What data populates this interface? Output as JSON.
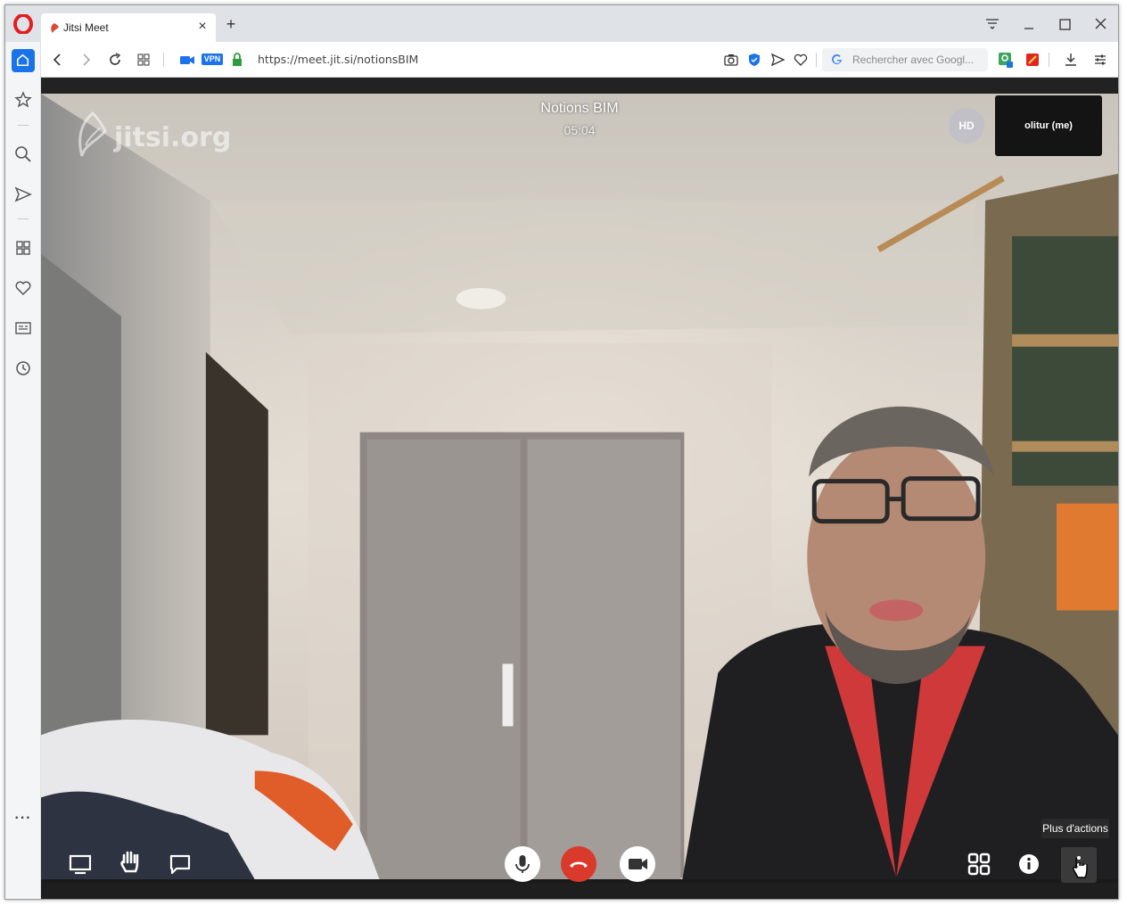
{
  "browser": {
    "tab_title": "Jitsi Meet",
    "tab_close": "×",
    "new_tab": "+",
    "url": "https://meet.jit.si/notionsBIM",
    "vpn_label": "VPN",
    "search_placeholder": "Rechercher avec Googl..."
  },
  "sidebar": {
    "items": [
      "home-icon",
      "star-icon",
      "search-icon",
      "send-icon",
      "apps-icon",
      "heart-icon",
      "news-icon",
      "history-icon"
    ],
    "more": "···"
  },
  "meeting": {
    "watermark": "jitsi.org",
    "title": "Notions BIM",
    "timer": "05:04",
    "quality_badge": "HD",
    "self_name": "olitur (me)",
    "tooltip": "Plus d'actions"
  },
  "colors": {
    "hangup": "#d93a2b",
    "accent": "#1a73e8"
  }
}
